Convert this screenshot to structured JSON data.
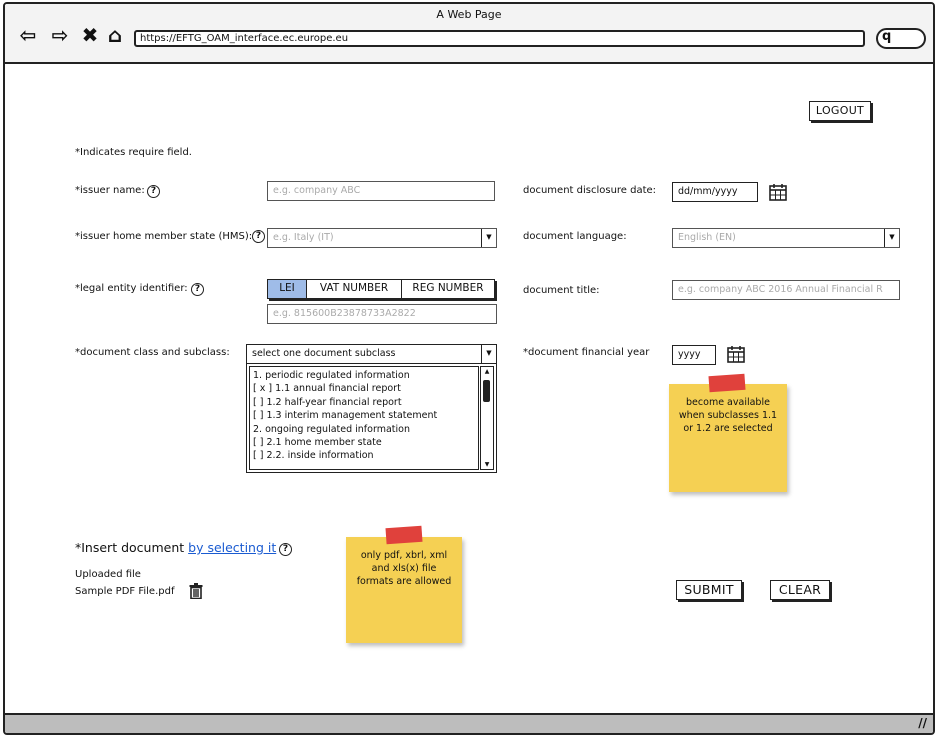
{
  "window": {
    "title": "A Web Page",
    "url": "https://EFTG_OAM_interface.ec.europe.eu"
  },
  "header": {
    "logout_label": "LOGOUT"
  },
  "form": {
    "required_note": "*Indicates require field.",
    "issuer_name": {
      "label": "*issuer name:",
      "placeholder": "e.g. company ABC"
    },
    "hms": {
      "label": "*issuer home member state (HMS):",
      "placeholder": "e.g. Italy (IT)"
    },
    "lei": {
      "label": "*legal entity identifier:",
      "tabs": [
        "LEI",
        "VAT NUMBER",
        "REG NUMBER"
      ],
      "placeholder": "e.g. 815600B23878733A2822"
    },
    "doc_class": {
      "label": "*document class and subclass:",
      "selected": "select one document subclass",
      "options": [
        "1. periodic regulated information",
        "[ x ] 1.1 annual financial report",
        "[    ] 1.2 half-year financial report",
        "[    ] 1.3 interim management statement",
        "2. ongoing regulated information",
        "[    ] 2.1 home member state",
        "[    ] 2.2. inside information"
      ]
    },
    "disclosure_date": {
      "label": "document disclosure date:",
      "value": "dd/mm/yyyy"
    },
    "language": {
      "label": "document language:",
      "placeholder": "English (EN)"
    },
    "title": {
      "label": "document title:",
      "placeholder": "e.g. company ABC 2016 Annual Financial R"
    },
    "financial_year": {
      "label": "*document financial year",
      "value": "yyyy"
    }
  },
  "notes": {
    "year_note": "become available when subclasses 1.1 or 1.2 are selected",
    "format_note": "only pdf, xbrl, xml and xls(x) file formats are allowed"
  },
  "upload": {
    "title": "*Insert document",
    "link": "by selecting it",
    "uploaded_label": "Uploaded file",
    "file_name": "Sample PDF File.pdf"
  },
  "actions": {
    "submit_label": "SUBMIT",
    "clear_label": "CLEAR"
  },
  "icons": {
    "back": "back-arrow-icon",
    "forward": "forward-arrow-icon",
    "stop": "close-icon",
    "home": "home-icon",
    "search": "search-icon",
    "help": "help-icon",
    "calendar": "calendar-icon",
    "trash": "trash-icon",
    "dropdown": "chevron-down-icon"
  }
}
